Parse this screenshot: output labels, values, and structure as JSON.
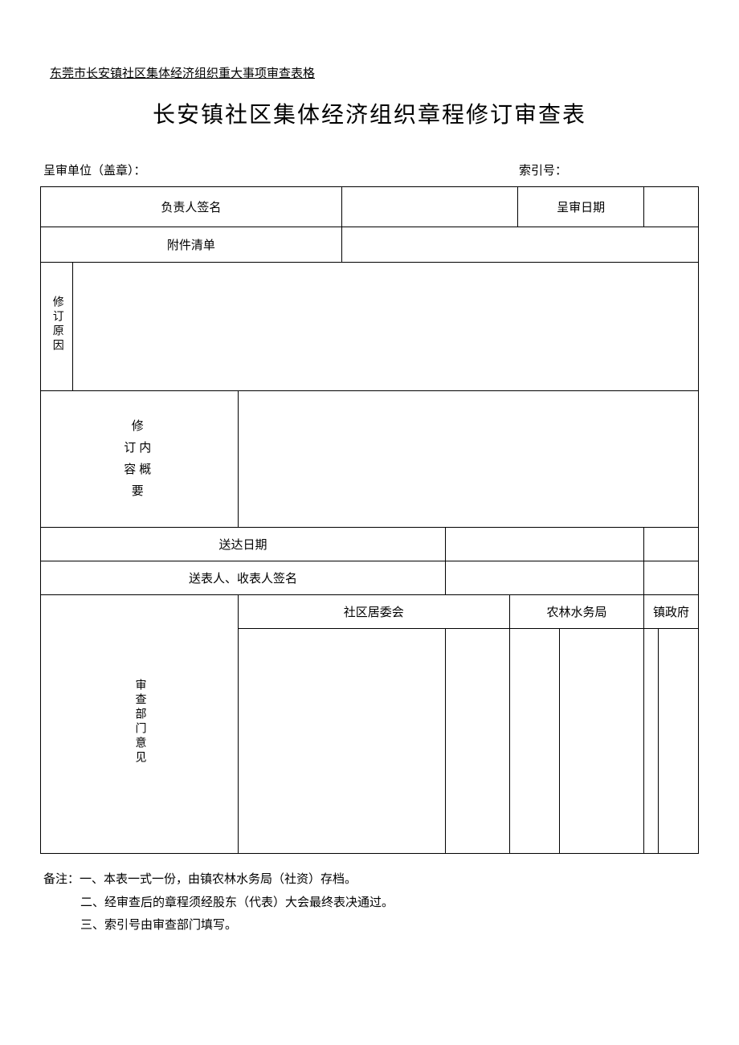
{
  "header": "东莞市长安镇社区集体经济组织重大事项审查表格",
  "title": "长安镇社区集体经济组织章程修订审查表",
  "preTable": {
    "unit": "呈审单位（盖章）：",
    "index": "索引号："
  },
  "labels": {
    "signer": "负责人签名",
    "submitDate": "呈审日期",
    "attachments": "附件清单",
    "revisionReason": "修订原因",
    "revisionContent": "修 订内 容概 要",
    "deliveryDate": "送达日期",
    "delivererSignature": "送表人、收表人签名",
    "reviewDept": "审查部门意见",
    "dept1": "社区居委会",
    "dept2": "农林水务局",
    "dept3": "镇政府"
  },
  "notes": {
    "prefix": "备注：",
    "line1": "一、本表一式一份，由镇农林水务局（社资）存档。",
    "line2": "二、经审查后的章程须经股东（代表）大会最终表决通过。",
    "line3": "三、索引号由审查部门填写。"
  }
}
